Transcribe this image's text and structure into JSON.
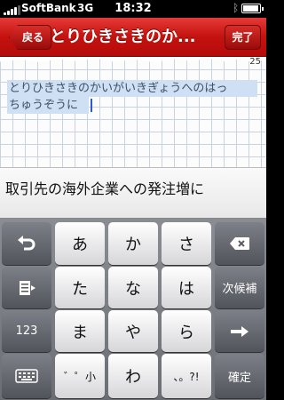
{
  "status_bar": {
    "carrier": "SoftBank",
    "network": "3G",
    "time": "18:32"
  },
  "nav": {
    "back_label": "戻る",
    "title": "とりひきさきのか...",
    "done_label": "完了"
  },
  "note": {
    "page_number": "25",
    "line_1": "とりひきさきのかいがいきぎょうへのはっ",
    "line_2": "ちゅうぞうに"
  },
  "candidate": {
    "text": "取引先の海外企業への発注増に"
  },
  "keyboard": {
    "undo_icon": "undo-arrow-icon",
    "delete_icon": "backspace-icon",
    "next_candidate_icon": "next-candidate-icon",
    "enter_icon": "arrow-right-icon",
    "keyboard_icon": "keyboard-icon",
    "row1": [
      "あ",
      "か",
      "さ"
    ],
    "row2": [
      "た",
      "な",
      "は"
    ],
    "row3": [
      "ま",
      "や",
      "ら"
    ],
    "row4": [
      "゛゜小",
      "わ",
      "、。?!"
    ],
    "next_candidate_label": "次候補",
    "numbers_label": "123",
    "confirm_label": "確定"
  }
}
